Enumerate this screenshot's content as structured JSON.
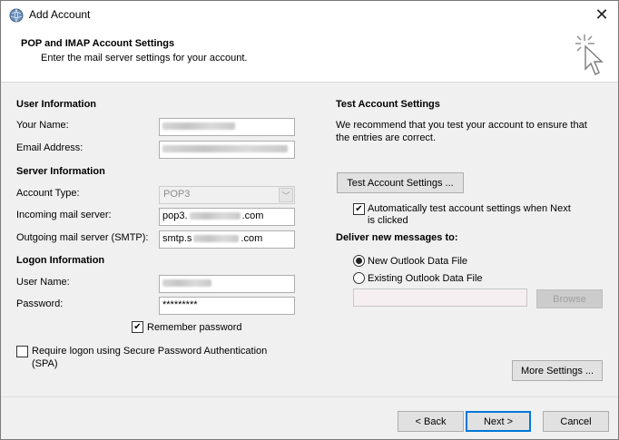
{
  "window": {
    "title": "Add Account",
    "close_glyph": "✕"
  },
  "header": {
    "title": "POP and IMAP Account Settings",
    "subtitle": "Enter the mail server settings for your account."
  },
  "user_info": {
    "heading": "User Information",
    "name_label": "Your Name:",
    "email_label": "Email Address:"
  },
  "server_info": {
    "heading": "Server Information",
    "account_type_label": "Account Type:",
    "account_type_value": "POP3",
    "incoming_label": "Incoming mail server:",
    "incoming_prefix": "pop3.",
    "incoming_suffix": ".com",
    "outgoing_label": "Outgoing mail server (SMTP):",
    "outgoing_prefix": "smtp.s",
    "outgoing_suffix": ".com"
  },
  "logon_info": {
    "heading": "Logon Information",
    "username_label": "User Name:",
    "password_label": "Password:",
    "password_value": "*********",
    "remember_label": "Remember password",
    "remember_checked": true,
    "spa_label_line1": "Require logon using Secure Password Authentication",
    "spa_label_line2": "(SPA)",
    "spa_checked": false
  },
  "test_settings": {
    "heading": "Test Account Settings",
    "description_line1": "We recommend that you test your account to ensure that",
    "description_line2": "the entries are correct.",
    "test_button": "Test Account Settings ...",
    "auto_test_line1": "Automatically test account settings when Next",
    "auto_test_line2": "is clicked",
    "auto_test_checked": true
  },
  "deliver": {
    "heading": "Deliver new messages to:",
    "new_file_label": "New Outlook Data File",
    "existing_file_label": "Existing Outlook Data File",
    "selected": "new",
    "browse_button": "Browse"
  },
  "more_settings_button": "More Settings ...",
  "footer": {
    "back_button": "< Back",
    "next_button": "Next >",
    "cancel_button": "Cancel"
  },
  "colors": {
    "accent": "#0078d7",
    "dialog_bg": "#f0f0f0"
  },
  "icons": [
    "outlook-globe-icon",
    "close-icon",
    "wizard-cursor-icon",
    "checkmark-icon",
    "dropdown-arrow-icon"
  ]
}
